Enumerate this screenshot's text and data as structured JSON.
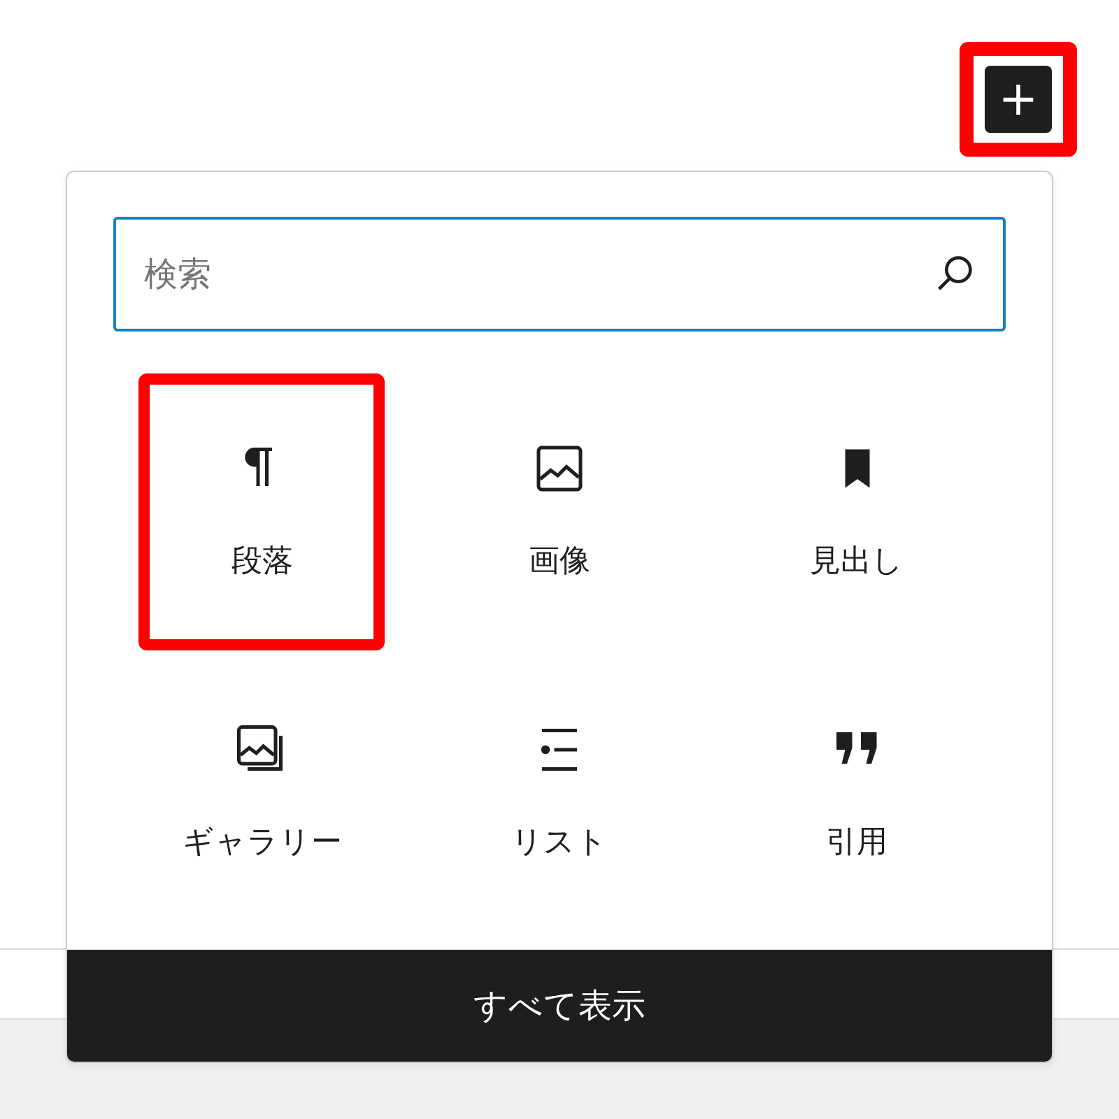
{
  "add_block_button": {
    "label": "+",
    "highlighted": true
  },
  "inserter": {
    "search": {
      "placeholder": "検索"
    },
    "blocks": [
      {
        "label": "段落",
        "highlighted": true
      },
      {
        "label": "画像",
        "highlighted": false
      },
      {
        "label": "見出し",
        "highlighted": false
      },
      {
        "label": "ギャラリー",
        "highlighted": false
      },
      {
        "label": "リスト",
        "highlighted": false
      },
      {
        "label": "引用",
        "highlighted": false
      }
    ],
    "browse_all": "すべて表示"
  }
}
